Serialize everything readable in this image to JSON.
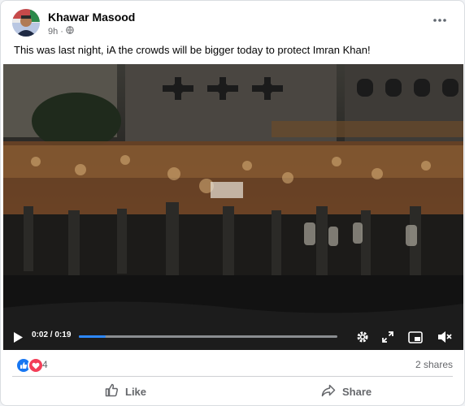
{
  "post": {
    "author": "Khawar Masood",
    "time": "9h",
    "caption": "This was last night, iA the crowds will be bigger today to protect Imran Khan!"
  },
  "icons": {
    "more": "more-horizontal-icon",
    "privacy": "globe-icon",
    "play": "play-icon",
    "settings": "gear-icon",
    "fullscreen": "expand-icon",
    "pip": "picture-in-picture-icon",
    "volume": "muted-speaker-icon",
    "like": "thumbs-up-icon",
    "share": "share-arrow-icon"
  },
  "video": {
    "current_time": "0:02",
    "duration": "0:19",
    "progress": 0.105
  },
  "stats": {
    "reactions": "4",
    "shares": "2 shares"
  },
  "actions": {
    "like": "Like",
    "share": "Share"
  },
  "colors": {
    "accent": "#2d88ff",
    "like_reaction": "#1877f2",
    "love_reaction": "#f33e58",
    "muted_text": "#65676b"
  }
}
